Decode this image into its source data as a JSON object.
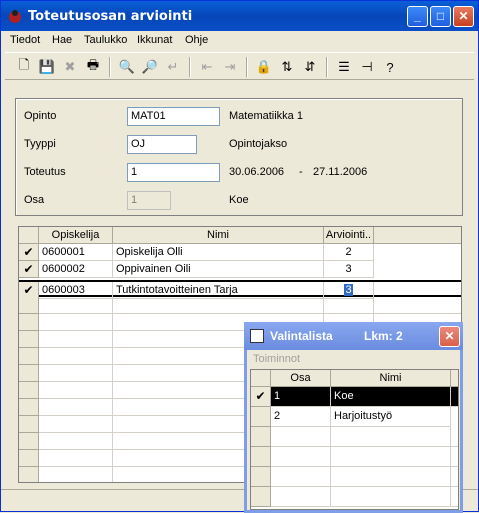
{
  "window": {
    "title": "Toteutusosan arviointi",
    "minimize": "_",
    "maximize": "□",
    "close": "✕"
  },
  "menu": [
    "Tiedot",
    "Hae",
    "Taulukko",
    "Ikkunat",
    "Ohje"
  ],
  "toolbar_icons": [
    "new-icon",
    "save-icon",
    "delete-icon",
    "print-icon",
    "print-preview-icon",
    "find-icon",
    "exit-icon",
    "move-left-icon",
    "move-right-icon",
    "lock-icon",
    "sort-asc-icon",
    "sort-desc-icon",
    "list-icon",
    "pin-icon",
    "help-icon"
  ],
  "form": {
    "opinto_label": "Opinto",
    "opinto_value": "MAT01",
    "opinto_name": "Matematiikka 1",
    "tyyppi_label": "Tyyppi",
    "tyyppi_value": "OJ",
    "tyyppi_name": "Opintojakso",
    "toteutus_label": "Toteutus",
    "toteutus_value": "1",
    "toteutus_start": "30.06.2006",
    "toteutus_dash": "-",
    "toteutus_end": "27.11.2006",
    "osa_label": "Osa",
    "osa_value": "1",
    "osa_name": "Koe"
  },
  "grid": {
    "headers": {
      "opiskelija": "Opiskelija",
      "nimi": "Nimi",
      "arviointi": "Arviointi.."
    },
    "rows": [
      {
        "check": "✔",
        "opiskelija": "0600001",
        "nimi": "Opiskelija Olli",
        "arviointi": "2"
      },
      {
        "check": "✔",
        "opiskelija": "0600002",
        "nimi": "Oppivainen Oili",
        "arviointi": "3"
      },
      {
        "check": "✔",
        "opiskelija": "0600003",
        "nimi": "Tutkintotavoitteinen Tarja",
        "arviointi": "3"
      }
    ]
  },
  "popup": {
    "title": "Valintalista",
    "count": "Lkm: 2",
    "close": "✕",
    "menu": "Toiminnot",
    "headers": {
      "osa": "Osa",
      "nimi": "Nimi"
    },
    "rows": [
      {
        "check": "✔",
        "osa": "1",
        "nimi": "Koe"
      },
      {
        "check": "",
        "osa": "2",
        "nimi": "Harjoitustyö"
      }
    ]
  }
}
